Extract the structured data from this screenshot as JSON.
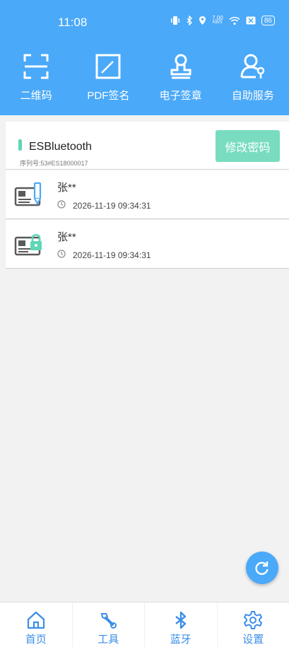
{
  "status_bar": {
    "time": "11:08",
    "net_speed_value": "7.00",
    "net_speed_unit": "KB/S",
    "battery": "86"
  },
  "quick_actions": [
    {
      "label": "二维码",
      "icon": "qr-scan-icon"
    },
    {
      "label": "PDF签名",
      "icon": "pdf-sign-icon"
    },
    {
      "label": "电子签章",
      "icon": "seal-stamp-icon"
    },
    {
      "label": "自助服务",
      "icon": "self-service-icon"
    }
  ],
  "device": {
    "name": "ESBluetooth",
    "serial": "序列号:53#ES18000017",
    "change_password_label": "修改密码"
  },
  "records": [
    {
      "name": "张**",
      "time": "2026-11-19 09:34:31",
      "icon": "certificate-pen-icon"
    },
    {
      "name": "张**",
      "time": "2026-11-19 09:34:31",
      "icon": "certificate-lock-icon"
    }
  ],
  "tabs": [
    {
      "label": "首页",
      "icon": "home-icon"
    },
    {
      "label": "工具",
      "icon": "wrench-icon"
    },
    {
      "label": "蓝牙",
      "icon": "bluetooth-icon"
    },
    {
      "label": "设置",
      "icon": "gear-icon"
    }
  ],
  "colors": {
    "header_blue": "#4aa9f8",
    "accent_green": "#79dcc0",
    "tab_blue": "#3b8ee8"
  }
}
